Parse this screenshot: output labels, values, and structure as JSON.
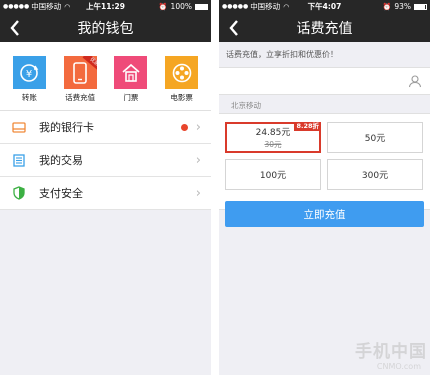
{
  "left_screen": {
    "status": {
      "carrier": "中国移动",
      "time": "上午11:29",
      "battery": "100%",
      "battery_level": 1.0
    },
    "nav_title": "我的钱包",
    "shortcuts": [
      {
        "label": "转账",
        "icon": "transfer-icon",
        "color": "#3aa0e8"
      },
      {
        "label": "话费充值",
        "icon": "phone-icon",
        "color": "#f36a3e",
        "ribbon": "优惠"
      },
      {
        "label": "门票",
        "icon": "house-icon",
        "color": "#ef4b79"
      },
      {
        "label": "电影票",
        "icon": "film-reel-icon",
        "color": "#f5a623"
      }
    ],
    "menu": [
      {
        "label": "我的银行卡",
        "icon": "bank-card-icon",
        "icon_color": "#f08a3a",
        "has_dot": true
      },
      {
        "label": "我的交易",
        "icon": "list-icon",
        "icon_color": "#3aa0e8",
        "has_dot": false
      },
      {
        "label": "支付安全",
        "icon": "shield-icon",
        "icon_color": "#3cb043",
        "has_dot": false
      }
    ]
  },
  "right_screen": {
    "status": {
      "carrier": "中国移动",
      "time": "下午4:07",
      "battery": "93%",
      "battery_level": 0.93
    },
    "nav_title": "话费充值",
    "promo_text": "话费充值，立享折扣和优惠价！",
    "phone_input": {
      "value": "",
      "placeholder": ""
    },
    "carrier_label": "北京移动",
    "amounts": [
      {
        "price": "24.85元",
        "original": "30元",
        "tag": "8.28折",
        "selected": true
      },
      {
        "price": "50元",
        "selected": false
      },
      {
        "price": "100元",
        "selected": false
      },
      {
        "price": "300元",
        "selected": false
      }
    ],
    "submit_label": "立即充值"
  },
  "watermark": {
    "main": "手机中国",
    "sub": "CNMO.com"
  },
  "colors": {
    "statusbar": "#272727",
    "accent_blue": "#3f9cf0",
    "accent_red": "#d93a2b",
    "background": "#efeff4"
  }
}
